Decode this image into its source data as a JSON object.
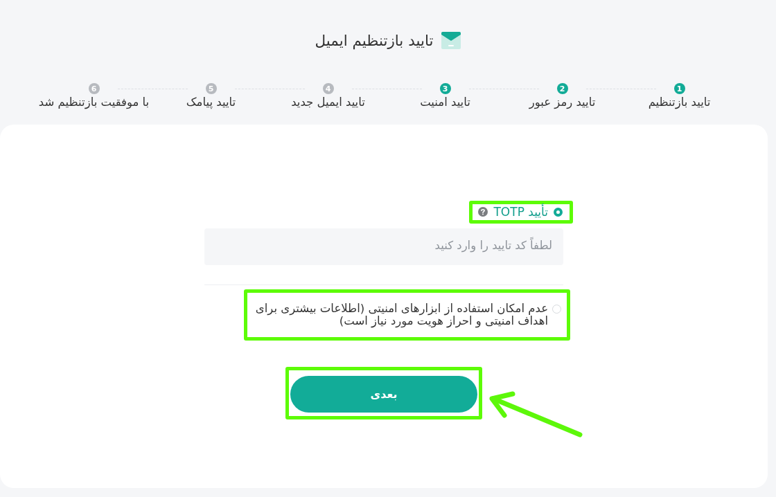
{
  "header": {
    "title": "تایید بازتنظیم ایمیل"
  },
  "steps": [
    {
      "number": "1",
      "label": "تایید بازتنظیم",
      "done": true
    },
    {
      "number": "2",
      "label": "تایید رمز عبور",
      "done": true
    },
    {
      "number": "3",
      "label": "تایید امنیت",
      "done": true
    },
    {
      "number": "4",
      "label": "تایید ایمیل جدید",
      "done": false
    },
    {
      "number": "5",
      "label": "تایید پیامک",
      "done": false
    },
    {
      "number": "6",
      "label": "با موفقیت بازتنظیم شد",
      "done": false
    }
  ],
  "options": [
    {
      "kind": "code",
      "label": "تأیید TOTP",
      "selected": true,
      "highlighted": true,
      "input": {
        "placeholder": "لطفاً کد تایید را وارد کنید"
      }
    },
    {
      "kind": "text",
      "label": "عدم امکان استفاده از ابزارهای امنیتی (اطلاعات بیشتری برای اهداف امنیتی و احراز هویت مورد نیاز است)",
      "selected": false,
      "highlighted": true
    }
  ],
  "next_button": {
    "label": "بعدی",
    "highlighted": true,
    "arrow": true
  }
}
